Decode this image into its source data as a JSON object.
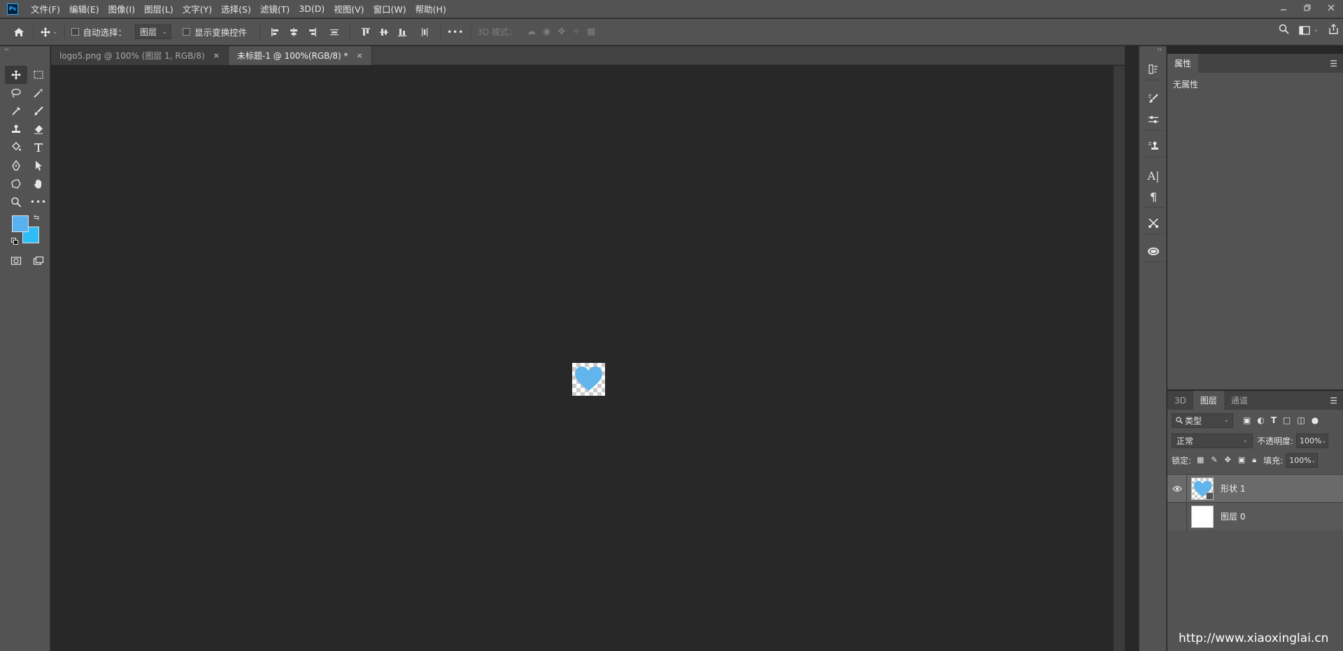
{
  "menu": [
    "文件(F)",
    "编辑(E)",
    "图像(I)",
    "图层(L)",
    "文字(Y)",
    "选择(S)",
    "滤镜(T)",
    "3D(D)",
    "视图(V)",
    "窗口(W)",
    "帮助(H)"
  ],
  "app_logo": "Ps",
  "options_bar": {
    "auto_select_label": "自动选择：",
    "auto_select_value": "图层",
    "show_transform_label": "显示变换控件",
    "mode_3d_label": "3D 模式：",
    "more": "•••"
  },
  "tabs": [
    {
      "label": "logo5.png @ 100% (图层 1, RGB/8)",
      "active": false
    },
    {
      "label": "未标题-1 @ 100%(RGB/8) *",
      "active": true
    }
  ],
  "colors": {
    "foreground": "#5ab1ef",
    "background": "#2ebdf6",
    "heart": "#62b4ec"
  },
  "properties_panel": {
    "tab": "属性",
    "body": "无属性"
  },
  "layers_panel": {
    "tabs": [
      "3D",
      "图层",
      "通道"
    ],
    "active_tab": "图层",
    "filter_label": "类型",
    "blend_mode": "正常",
    "opacity_label": "不透明度:",
    "opacity_value": "100%",
    "lock_label": "锁定:",
    "fill_label": "填充:",
    "fill_value": "100%",
    "layers": [
      {
        "name": "形状 1",
        "visible": true,
        "selected": true
      },
      {
        "name": "图层 0",
        "visible": false,
        "selected": false
      }
    ]
  },
  "watermark": "http://www.xiaoxinglai.cn"
}
